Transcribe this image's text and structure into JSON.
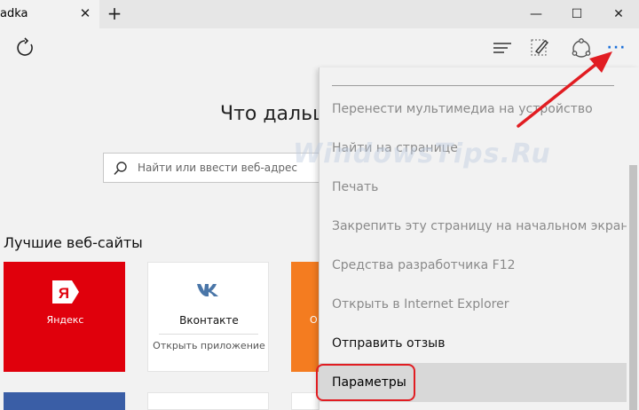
{
  "tab": {
    "title": "adka",
    "close": "✕"
  },
  "new_tab": "+",
  "window": {
    "minimize": "—",
    "maximize": "☐",
    "close": "✕"
  },
  "toolbar": {
    "more": "···"
  },
  "colors": {
    "accent": "#1a6fd9",
    "annotation": "#e11d22",
    "yandex": "#e0000c",
    "vk": "#4a76a8"
  },
  "page": {
    "heading": "Что дальш",
    "search_placeholder": "Найти или ввести веб-адрес",
    "sites_heading": "Лучшие веб-сайты"
  },
  "tiles": {
    "yandex": {
      "logo": "Я",
      "label": "Яндекс"
    },
    "vk": {
      "label": "Вконтакте",
      "action": "Открыть приложение"
    },
    "orange": {
      "label": "О"
    }
  },
  "menu": {
    "items": [
      {
        "label": "Перенести мультимедиа на устройство",
        "state": "disabled"
      },
      {
        "label": "Найти на странице",
        "state": "disabled"
      },
      {
        "label": "Печать",
        "state": "disabled"
      },
      {
        "label": "Закрепить эту страницу на начальном экране",
        "state": "disabled"
      },
      {
        "label": "Средства разработчика F12",
        "state": "disabled"
      },
      {
        "label": "Открыть в Internet Explorer",
        "state": "disabled"
      },
      {
        "label": "Отправить отзыв",
        "state": "enabled"
      },
      {
        "label": "Параметры",
        "state": "selected"
      }
    ]
  },
  "watermark": "WindowsTips.Ru"
}
